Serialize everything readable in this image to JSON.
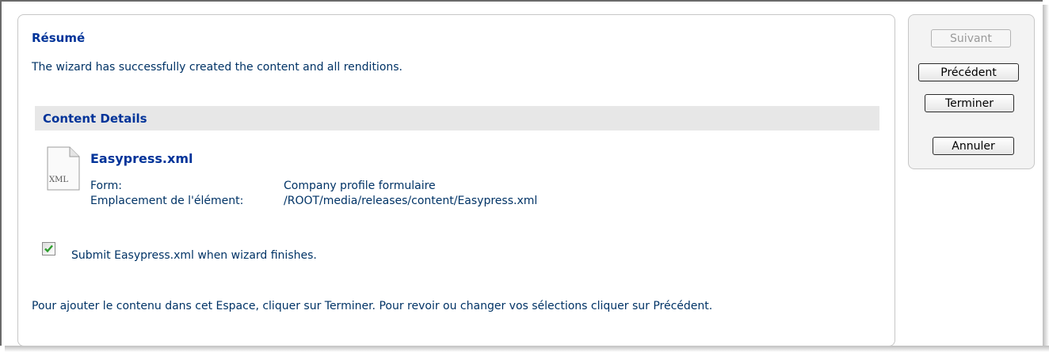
{
  "summary": {
    "title": "Résumé",
    "intro": "The wizard has successfully created the content and all renditions."
  },
  "details": {
    "header": "Content Details",
    "file_icon": "xml-file-icon",
    "file_icon_text": "XML",
    "file_name": "Easypress.xml",
    "form_label": "Form:",
    "form_value": "Company profile formulaire",
    "location_label": "Emplacement de l'élément:",
    "location_value": "/ROOT/media/releases/content/Easypress.xml"
  },
  "submit_checkbox": {
    "checked": true,
    "label": "Submit Easypress.xml when wizard finishes."
  },
  "footer": {
    "text": "Pour ajouter le contenu dans cet Espace, cliquer sur Terminer. Pour revoir ou changer vos sélections cliquer sur Précédent."
  },
  "buttons": {
    "next": "Suivant",
    "previous": "Précédent",
    "finish": "Terminer",
    "cancel": "Annuler"
  },
  "colors": {
    "heading": "#003399",
    "text": "#003366",
    "check": "#2e9e2e"
  }
}
